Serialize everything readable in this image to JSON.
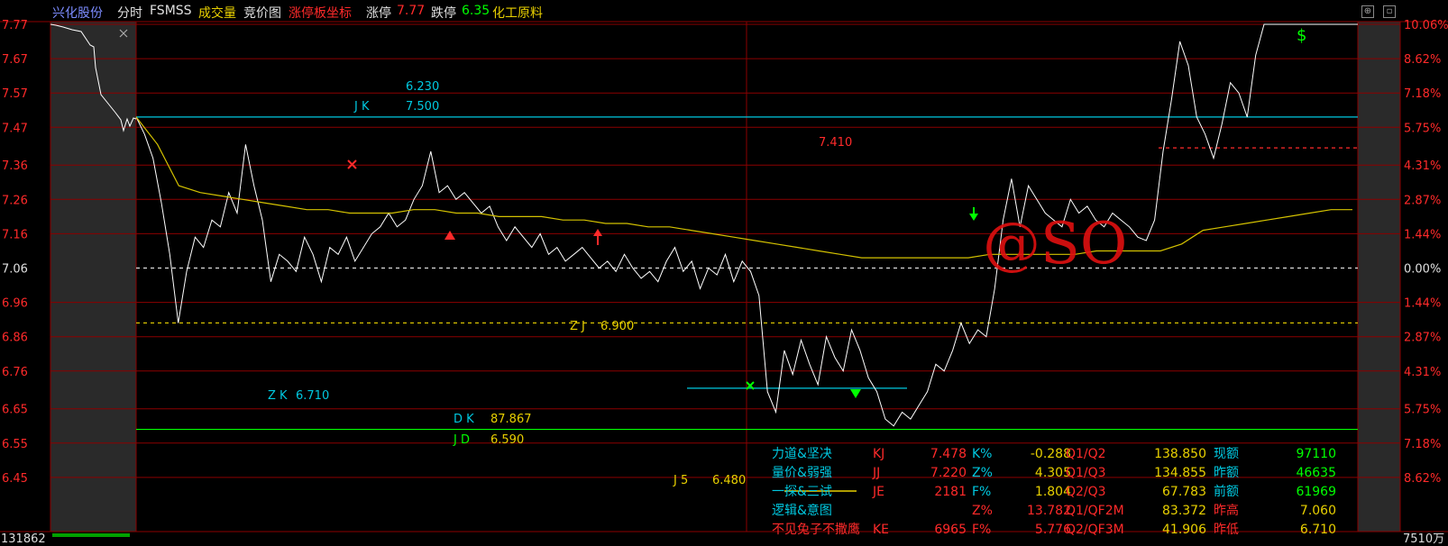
{
  "header": {
    "stock_name": "兴化股份",
    "mode_label": "分时",
    "indicator_name": "FSMSS",
    "volume_label": "成交量",
    "auction_label": "竞价图",
    "limit_coord_label": "涨停板坐标",
    "limit_up_label": "涨停",
    "limit_up_value": "7.77",
    "limit_down_label": "跌停",
    "limit_down_value": "6.35",
    "sector_label": "化工原料"
  },
  "colors": {
    "price_line": "#ffffff",
    "avg_line": "#d4c200",
    "grid": "#8b0000",
    "up_red": "#ff2a2a",
    "down_green": "#00ff00",
    "cyan": "#00c8e0",
    "yellow": "#e8d000"
  },
  "chart_data": {
    "type": "line",
    "base_price": 7.06,
    "ylim": [
      6.35,
      7.77
    ],
    "y_ticks": [
      "7.77",
      "7.67",
      "7.57",
      "7.47",
      "7.36",
      "7.26",
      "7.16",
      "7.06",
      "6.96",
      "6.86",
      "6.76",
      "6.65",
      "6.55",
      "6.45"
    ],
    "pct_ticks": [
      "10.06%",
      "8.62%",
      "7.18%",
      "5.75%",
      "4.31%",
      "2.87%",
      "1.44%",
      "0.00%",
      "1.44%",
      "2.87%",
      "4.31%",
      "5.75%",
      "7.18%",
      "8.62%"
    ],
    "volume_left": "131862",
    "volume_right": "7510万",
    "series": [
      {
        "values": [
          7.5,
          7.45,
          7.38,
          7.25,
          7.1,
          6.9,
          7.05,
          7.15,
          7.12,
          7.2,
          7.18,
          7.28,
          7.22,
          7.42,
          7.3,
          7.2,
          7.02,
          7.1,
          7.08,
          7.05,
          7.15,
          7.1,
          7.02,
          7.12,
          7.1,
          7.15,
          7.08,
          7.12,
          7.16,
          7.18,
          7.22,
          7.18,
          7.2,
          7.26,
          7.3,
          7.4,
          7.28,
          7.3,
          7.26,
          7.28,
          7.25,
          7.22,
          7.24,
          7.18,
          7.14,
          7.18,
          7.15,
          7.12,
          7.16,
          7.1,
          7.12,
          7.08,
          7.1,
          7.12,
          7.09,
          7.06,
          7.08,
          7.05,
          7.1,
          7.06,
          7.03,
          7.05,
          7.02,
          7.08,
          7.12,
          7.05,
          7.08,
          7.0,
          7.06,
          7.04,
          7.1,
          7.02,
          7.08,
          7.05,
          6.98,
          6.7,
          6.64,
          6.82,
          6.75,
          6.85,
          6.78,
          6.72,
          6.86,
          6.8,
          6.76,
          6.88,
          6.82,
          6.74,
          6.7,
          6.62,
          6.6,
          6.64,
          6.62,
          6.66,
          6.7,
          6.78,
          6.76,
          6.82,
          6.9,
          6.84,
          6.88,
          6.86,
          7.0,
          7.2,
          7.32,
          7.18,
          7.3,
          7.26,
          7.22,
          7.2,
          7.18,
          7.26,
          7.22,
          7.24,
          7.2,
          7.18,
          7.22,
          7.2,
          7.18,
          7.15,
          7.14,
          7.2,
          7.4,
          7.55,
          7.72,
          7.65,
          7.5,
          7.45,
          7.38,
          7.48,
          7.6,
          7.57,
          7.5,
          7.68,
          7.77,
          7.77,
          7.77,
          7.77
        ]
      },
      {
        "values": [
          7.5,
          7.42,
          7.3,
          7.28,
          7.27,
          7.26,
          7.25,
          7.24,
          7.23,
          7.23,
          7.22,
          7.22,
          7.22,
          7.23,
          7.23,
          7.22,
          7.22,
          7.21,
          7.21,
          7.21,
          7.2,
          7.2,
          7.19,
          7.19,
          7.18,
          7.18,
          7.17,
          7.16,
          7.15,
          7.14,
          7.13,
          7.12,
          7.11,
          7.1,
          7.09,
          7.09,
          7.09,
          7.09,
          7.09,
          7.09,
          7.1,
          7.1,
          7.1,
          7.1,
          7.1,
          7.11,
          7.11,
          7.11,
          7.11,
          7.13,
          7.17,
          7.18,
          7.19,
          7.2,
          7.21,
          7.22,
          7.23,
          7.23
        ]
      }
    ],
    "ref_lines": [
      {
        "value": 7.5,
        "color": "cyan",
        "style": "solid"
      },
      {
        "value": 7.06,
        "color": "white",
        "style": "dashed"
      },
      {
        "value": 6.9,
        "color": "yellow",
        "style": "dashed"
      },
      {
        "value": 6.59,
        "color": "green",
        "style": "solid"
      },
      {
        "value": 7.41,
        "color": "red",
        "style": "dashed",
        "from": 1285
      },
      {
        "value": 6.71,
        "color": "cyan",
        "style": "solid",
        "from": 762,
        "to": 1006
      }
    ],
    "annotations": {
      "jk_top": "6.230",
      "jk_label": "J K",
      "jk_value": "7.500",
      "red_val": "7.410",
      "zj_label": "Z J",
      "zj_value": "6.900",
      "zk_label": "Z K",
      "zk_value": "6.710",
      "dk_label": "D K",
      "dk_value": "87.867",
      "jd_label": "J D",
      "jd_value": "6.590",
      "j5_label": "J 5",
      "j5_value": "6.480",
      "watermark": "@SO"
    },
    "table": {
      "rows": [
        [
          "力道&坚决",
          "KJ",
          "7.478",
          "K%",
          "-0.288",
          "Q1/Q2",
          "138.850",
          "现额",
          "97110"
        ],
        [
          "量价&弱强",
          "JJ",
          "7.220",
          "Z%",
          "4.305",
          "Q1/Q3",
          "134.855",
          "昨额",
          "46635"
        ],
        [
          "一探&三试",
          "JE",
          "2181",
          "F%",
          "1.804",
          "Q2/Q3",
          "67.783",
          "前额",
          "61969"
        ],
        [
          "逻辑&意图",
          "",
          "",
          "Z%",
          "13.782",
          "Q1/QF2M",
          "83.372",
          "昨高",
          "7.060"
        ],
        [
          "不见兔子不撒鹰",
          "KE",
          "6965",
          "F%",
          "5.776",
          "Q2/QF3M",
          "41.906",
          "昨低",
          "6.710"
        ]
      ]
    }
  }
}
